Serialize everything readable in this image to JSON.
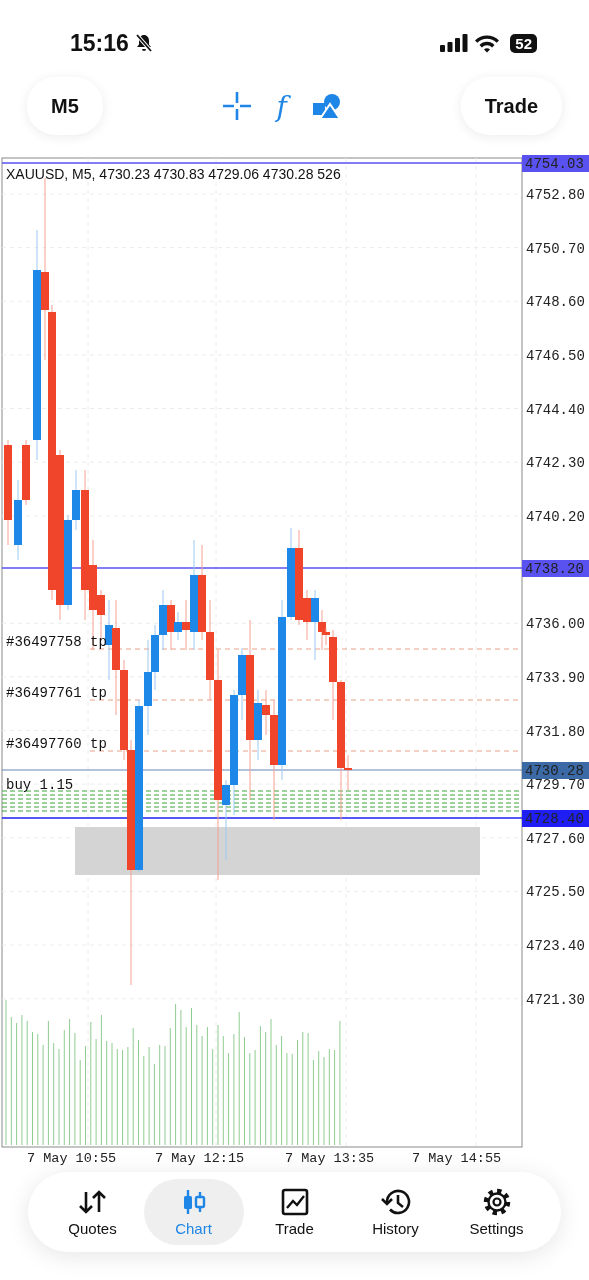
{
  "status_bar": {
    "time": "15:16",
    "battery": "52"
  },
  "toolbar": {
    "timeframe": "M5",
    "indicator_glyph": "f",
    "trade": "Trade"
  },
  "chart": {
    "info": "XAUUSD, M5, 4730.23 4730.83 4729.06 4730.28 526",
    "price_ticks": [
      "4752.80",
      "4750.70",
      "4748.60",
      "4746.50",
      "4744.40",
      "4742.30",
      "4740.20",
      "4736.00",
      "4733.90",
      "4731.80",
      "4729.70",
      "4727.60",
      "4725.50",
      "4723.40",
      "4721.30"
    ],
    "price_tags": [
      {
        "label": "4754.03",
        "color": "#5a52f0"
      },
      {
        "label": "4738.20",
        "color": "#5a52f0"
      },
      {
        "label": "4730.28",
        "color": "#3b6aa6"
      },
      {
        "label": "4728.40",
        "color": "#1f1ff5"
      }
    ],
    "order_labels": [
      "#36497758 tp",
      "#36497761 tp",
      "#36497760 tp"
    ],
    "position_label": "buy 1.15",
    "time_labels": [
      "7 May 10:55",
      "7 May 12:15",
      "7 May 13:35",
      "7 May 14:55"
    ]
  },
  "nav": [
    {
      "label": "Quotes",
      "selected": false
    },
    {
      "label": "Chart",
      "selected": true
    },
    {
      "label": "Trade",
      "selected": false
    },
    {
      "label": "History",
      "selected": false
    },
    {
      "label": "Settings",
      "selected": false
    }
  ]
}
